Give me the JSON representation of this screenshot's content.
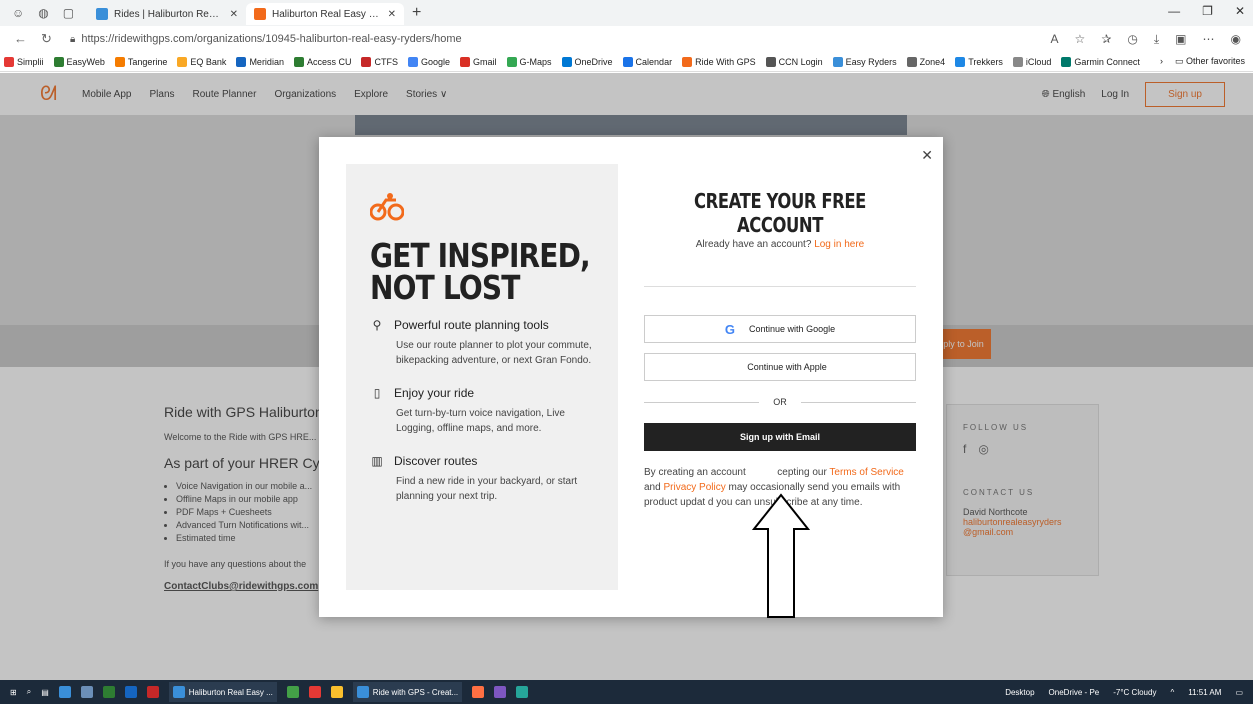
{
  "browser": {
    "tabs": [
      {
        "title": "Rides | Haliburton Real Easy Ryde",
        "active": false,
        "color": "#3a8fd9"
      },
      {
        "title": "Haliburton Real Easy Ryders - Cyc",
        "active": true,
        "color": "#f26a1b"
      }
    ],
    "url": "https://ridewithgps.com/organizations/10945-haliburton-real-easy-ryders/home",
    "bookmarks": [
      "Simplii",
      "EasyWeb",
      "Tangerine",
      "EQ Bank",
      "Meridian",
      "Access CU",
      "CTFS",
      "Google",
      "Gmail",
      "G-Maps",
      "OneDrive",
      "Calendar",
      "Ride With GPS",
      "CCN Login",
      "Easy Ryders",
      "Zone4",
      "Trekkers",
      "iCloud",
      "Garmin Connect"
    ],
    "other_favorites": "Other favorites"
  },
  "site_nav": {
    "items": [
      "Mobile App",
      "Plans",
      "Route Planner",
      "Organizations",
      "Explore",
      "Stories ∨"
    ],
    "language": "English",
    "login": "Log In",
    "signup": "Sign up"
  },
  "page": {
    "apply": "Apply to Join",
    "heading": "Ride with GPS Haliburton",
    "intro": "Welcome to the Ride with GPS HRE... have been categorized by starting l...",
    "subheading": "As part of your HRER Cy... club routes:",
    "benefits": [
      "Voice Navigation in our mobile a...",
      "Offline Maps in our mobile app",
      "PDF Maps + Cuesheets",
      "Advanced Turn Notifications wit...",
      "Estimated time"
    ],
    "questions": "If you have any questions about the",
    "contact_email": "ContactClubs@ridewithgps.com",
    "follow_us": "FOLLOW US",
    "contact_us": "CONTACT US",
    "contact_name": "David Northcote",
    "club_email": "haliburtonrealeasyryders @gmail.com"
  },
  "modal": {
    "left": {
      "headline": "GET INSPIRED, NOT LOST",
      "features": [
        {
          "icon": "route-pin-icon",
          "title": "Powerful route planning tools",
          "desc": "Use our route planner to plot your commute, bikepacking adventure, or next Gran Fondo."
        },
        {
          "icon": "phone-icon",
          "title": "Enjoy your ride",
          "desc": "Get turn-by-turn voice navigation, Live Logging, offline maps, and more."
        },
        {
          "icon": "map-icon",
          "title": "Discover routes",
          "desc": "Find a new ride in your backyard, or start planning your next trip."
        }
      ]
    },
    "right": {
      "title": "CREATE YOUR FREE ACCOUNT",
      "already": "Already have an account?",
      "login_link": "Log in here",
      "google": "Continue with Google",
      "apple": "Continue with Apple",
      "or": "OR",
      "email": "Sign up with Email",
      "terms_pre": "By creating an account",
      "terms_mid1": "cepting our",
      "terms_link1": "Terms of Service",
      "terms_and": "and",
      "terms_link2": "Privacy Policy",
      "terms_post": "may occasionally send you emails with product updat   d you can unsubscribe at any time."
    }
  },
  "taskbar": {
    "app1": "Haliburton Real Easy ...",
    "app2": "Ride with GPS - Creat...",
    "desktop": "Desktop",
    "onedrive": "OneDrive - Pe",
    "weather": "-7°C Cloudy",
    "time": "11:51 AM"
  }
}
